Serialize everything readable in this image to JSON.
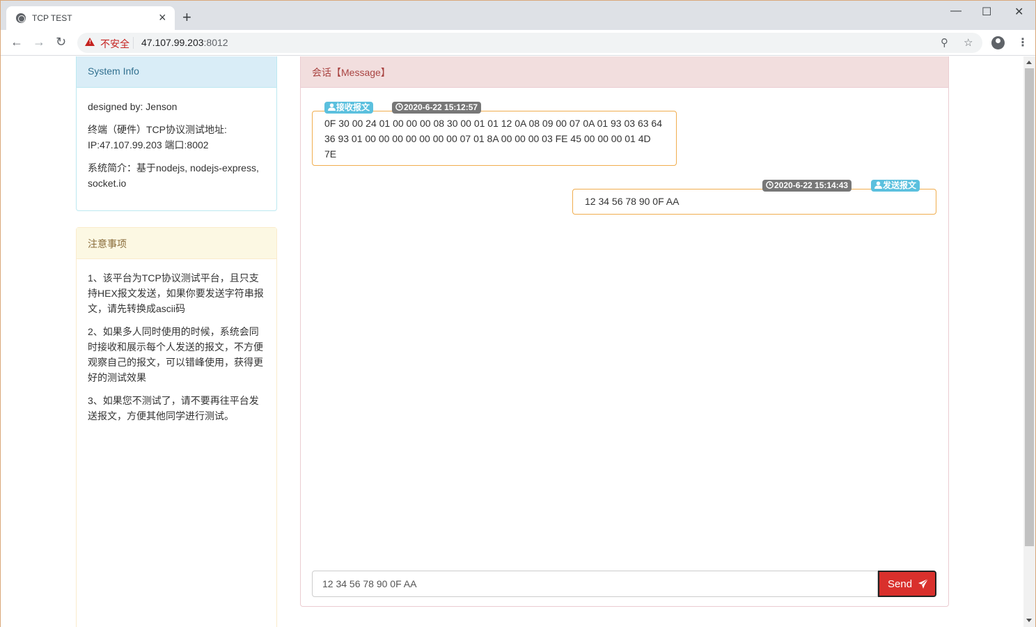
{
  "browser": {
    "tab_title": "TCP TEST",
    "tab_close": "×",
    "new_tab": "+",
    "insecure_label": "不安全",
    "url_host": "47.107.99.203",
    "url_port": ":8012",
    "minimize": "—",
    "maximize": "☐",
    "close": "✕"
  },
  "system_info": {
    "heading": "System Info",
    "designer": "designed by: Jenson",
    "address": "终端（硬件）TCP协议测试地址: IP:47.107.99.203 端口:8002",
    "intro": "系统简介：基于nodejs, nodejs-express, socket.io"
  },
  "notes": {
    "heading": "注意事项",
    "items": [
      "1、该平台为TCP协议测试平台，且只支持HEX报文发送，如果你要发送字符串报文，请先转换成ascii码",
      "2、如果多人同时使用的时候，系统会同时接收和展示每个人发送的报文，不方便观察自己的报文，可以错峰使用，获得更好的测试效果",
      "3、如果您不测试了，请不要再往平台发送报文，方便其他同学进行测试。"
    ]
  },
  "messages": {
    "heading": "会话【Message】",
    "received": {
      "label": "接收报文",
      "time": "2020-6-22 15:12:57",
      "content": "0F 30 00 24 01 00 00 00 08 30 00 01 01 12 0A 08 09 00 07 0A 01 93 03 63 64 36 93 01 00 00 00 00 00 00 00 07 01 8A 00 00 00 03 FE 45 00 00 00 01 4D 7E"
    },
    "sent": {
      "label": "发送报文",
      "time": "2020-6-22 15:14:43",
      "content": "12 34 56 78 90 0F AA"
    },
    "input_value": "12 34 56 78 90 0F AA",
    "send_label": "Send"
  },
  "colors": {
    "info_badge": "#5bc0de",
    "time_badge": "#777777",
    "send_button": "#d9302c",
    "bubble_border": "#f0ad4e"
  }
}
